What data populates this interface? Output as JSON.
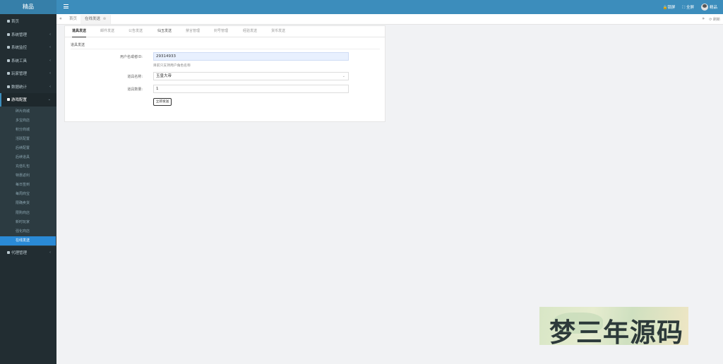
{
  "header": {
    "brand": "精品",
    "lock_label": "🔒锁屏",
    "fullscreen_label": "⛶ 全屏",
    "user_name": "精品"
  },
  "sidebar": {
    "items": [
      {
        "label": "首页"
      },
      {
        "label": "系统管理"
      },
      {
        "label": "系统监控"
      },
      {
        "label": "系统工具"
      },
      {
        "label": "玩家管理"
      },
      {
        "label": "数据统计"
      },
      {
        "label": "游戏配置"
      }
    ],
    "submenu": [
      "碎片商城",
      "多宝商店",
      "积分商城",
      "活跃配置",
      "后续配置",
      "后续道具",
      "充值礼包",
      "特惠返利",
      "每日签到",
      "每周商宝",
      "限确卖货",
      "限购商店",
      "新时玩家",
      "强化商店",
      "在线发送"
    ],
    "selected_sub": "在线发送",
    "after_items": [
      {
        "label": "代理管理"
      }
    ]
  },
  "tabbar": {
    "home": "首页",
    "current": "在线发送",
    "refresh": "⟳ 刷新"
  },
  "subtabs": [
    "道具发送",
    "邮件发送",
    "公告发送",
    "仙玉发送",
    "禁言管理",
    "封号管理",
    "经验发送",
    "货币发送"
  ],
  "form": {
    "section_title": "道具发送",
    "uid_label": "用户名或者ID:",
    "uid_value": "29314933",
    "uid_hint": "目前只支持用户角色名称",
    "item_label": "道具名称:",
    "item_value": "玉皇大帝",
    "qty_label": "道具数量:",
    "qty_value": "1",
    "submit_label": "立即发送"
  },
  "watermark": {
    "text": "梦三年源码"
  }
}
